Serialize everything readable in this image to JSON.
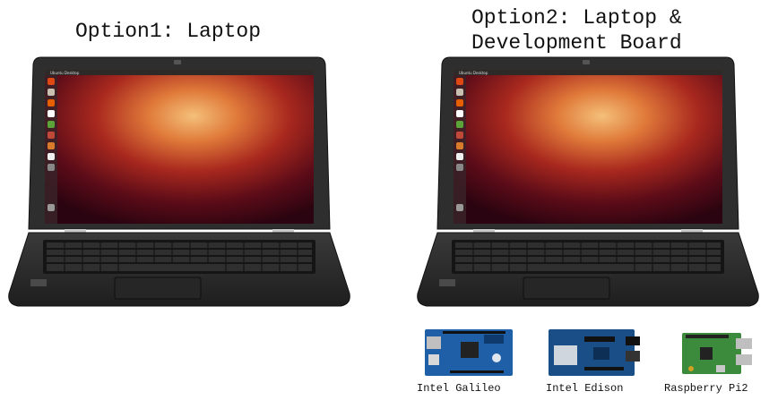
{
  "options": {
    "option1_title": "Option1: Laptop",
    "option2_title_line1": "Option2: Laptop &",
    "option2_title_line2": "Development Board"
  },
  "screen": {
    "topbar_text": "Ubuntu Desktop"
  },
  "boards": {
    "galileo_label": "Intel Galileo",
    "edison_label": "Intel Edison",
    "pi_label": "Raspberry Pi2"
  },
  "colors": {
    "laptop_body": "#2b2b2b",
    "bezel": "#111111",
    "wallpaper_dark": "#3a0710",
    "wallpaper_mid": "#9c2a1c",
    "wallpaper_light": "#f0b070",
    "galileo_board": "#1e5fa8",
    "edison_board": "#1a4e86",
    "pi_board": "#3c8a3c"
  },
  "icons": [
    "ubuntu-logo-icon",
    "files-icon",
    "browser-icon",
    "writer-icon",
    "calc-icon",
    "impress-icon",
    "software-center-icon",
    "amazon-icon",
    "settings-icon",
    "trash-icon"
  ]
}
